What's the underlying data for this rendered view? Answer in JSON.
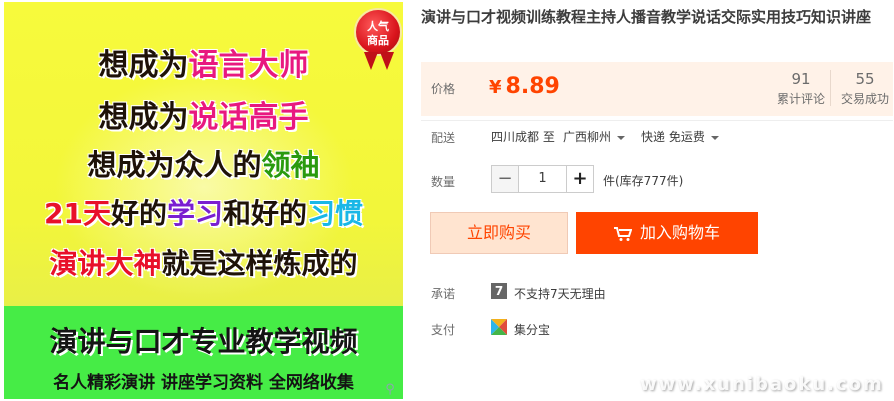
{
  "product_image": {
    "badge": {
      "line1": "人气",
      "line2": "商品"
    },
    "lines": [
      [
        {
          "t": "想成为",
          "c": "#1e1208"
        },
        {
          "t": "语言大师",
          "c": "#e8197f"
        }
      ],
      [
        {
          "t": "想成为",
          "c": "#1e1208"
        },
        {
          "t": "说话高手",
          "c": "#e8197f"
        }
      ],
      [
        {
          "t": "想成为众人的",
          "c": "#1e1208"
        },
        {
          "t": "领袖",
          "c": "#2a9a0e"
        }
      ],
      [
        {
          "t": "21天",
          "c": "#e8102a"
        },
        {
          "t": "好的",
          "c": "#1e1208"
        },
        {
          "t": "学习",
          "c": "#7a1fd0"
        },
        {
          "t": "和好的",
          "c": "#1e1208"
        },
        {
          "t": "习惯",
          "c": "#19b7e6"
        }
      ],
      [
        {
          "t": "演讲大神",
          "c": "#e8102a"
        },
        {
          "t": "就是这样炼成的",
          "c": "#1e1208"
        }
      ]
    ],
    "band_title": "演讲与口才专业教学视频",
    "band_sub": "名人精彩演讲 讲座学习资料 全网络收集"
  },
  "title": "演讲与口才视频训练教程主持人播音教学说话交际实用技巧知识讲座",
  "price": {
    "label": "价格",
    "currency": "¥",
    "value": "8.89"
  },
  "stats": [
    {
      "num": "91",
      "caption": "累计评论"
    },
    {
      "num": "55",
      "caption": "交易成功"
    }
  ],
  "shipping": {
    "label": "配送",
    "from": "四川成都 至",
    "to": "广西柳州",
    "method": "快递 免运费"
  },
  "quantity": {
    "label": "数量",
    "minus": "−",
    "value": "1",
    "plus": "+",
    "stock": "件(库存777件)"
  },
  "buttons": {
    "buy_now": "立即购买",
    "add_cart": "加入购物车"
  },
  "promise": {
    "label": "承诺",
    "icon_text": "7",
    "text": "不支持7天无理由"
  },
  "payment": {
    "label": "支付",
    "text": "集分宝"
  },
  "watermark": "www.xunibaoku.com",
  "colors": {
    "accent": "#ff4400",
    "price_bg": "#fff2e8"
  }
}
